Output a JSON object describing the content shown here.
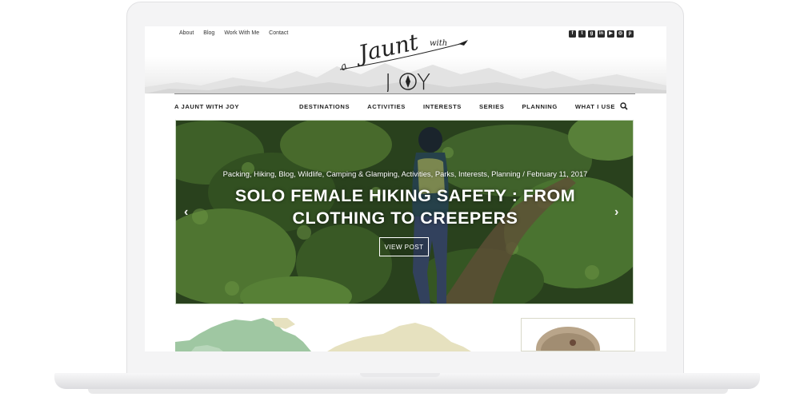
{
  "site": {
    "top_links": [
      "About",
      "Blog",
      "Work With Me",
      "Contact"
    ],
    "social_icons": [
      "facebook-icon",
      "twitter-icon",
      "google-plus-icon",
      "linkedin-icon",
      "youtube-icon",
      "instagram-icon",
      "pinterest-icon"
    ],
    "logo": {
      "line1": "a",
      "line2": "Jaunt",
      "line3": "with",
      "line4": "J",
      "line5": "Y"
    },
    "brand": "A JAUNT WITH JOY",
    "nav": [
      "DESTINATIONS",
      "ACTIVITIES",
      "INTERESTS",
      "SERIES",
      "PLANNING",
      "WHAT I USE"
    ]
  },
  "hero": {
    "meta": "Packing, Hiking, Blog, Wildlife, Camping & Glamping, Activities, Parks, Interests, Planning / February 11, 2017",
    "title_line1": "SOLO FEMALE HIKING SAFETY : FROM",
    "title_line2": "CLOTHING TO CREEPERS",
    "button": "VIEW POST",
    "prev": "‹",
    "next": "›"
  },
  "colors": {
    "map_green": "#9fc7a2",
    "map_beige": "#e6e1bf",
    "foliage_dark": "#2f4a22",
    "foliage_light": "#5f8d3b"
  }
}
